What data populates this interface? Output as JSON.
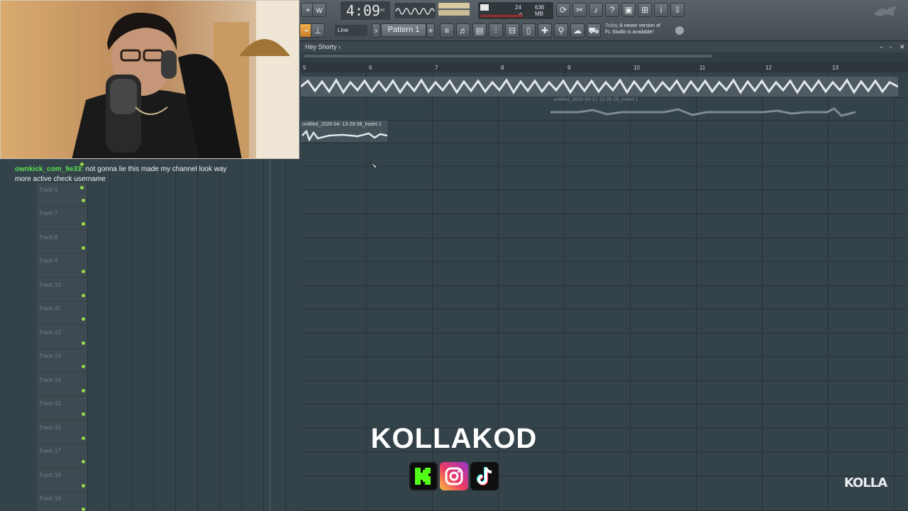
{
  "toolbar": {
    "time": "4:09",
    "time_small": "00",
    "time_unit": "B:S:T",
    "cpu_voices": "24",
    "cpu_zero": "0",
    "memory": "636 MB",
    "snap": "Line",
    "pattern": "Pattern 1",
    "news_today": "Today",
    "news_line1": "A newer version of",
    "news_line2": "FL Studio is available!"
  },
  "playlist": {
    "title": "Hey Shorty",
    "ruler_marks": [
      "5",
      "6",
      "7",
      "8",
      "9",
      "10",
      "11",
      "12",
      "13"
    ],
    "clip_top_label": "untitled_2026-04- 13-29-39_Insert 1",
    "clip_faint_label": "untitled_2026-04-12 13-26-28_Insert 1",
    "window_controls": [
      "–",
      "▫",
      "✕"
    ]
  },
  "tracks": [
    {
      "name": "Track 6"
    },
    {
      "name": "Track 7"
    },
    {
      "name": "Track 8"
    },
    {
      "name": "Track 9"
    },
    {
      "name": "Track 10"
    },
    {
      "name": "Track 11"
    },
    {
      "name": "Track 12"
    },
    {
      "name": "Track 13"
    },
    {
      "name": "Track 14"
    },
    {
      "name": "Track 15"
    },
    {
      "name": "Track 16"
    },
    {
      "name": "Track 17"
    },
    {
      "name": "Track 18"
    },
    {
      "name": "Track 19"
    }
  ],
  "chat": {
    "username": "ownkick_com_9e33:",
    "message": "not gonna lie this made my channel look way more active check username"
  },
  "branding": {
    "title": "KOLLAKOD",
    "watermark": "KOLLA",
    "social_icons": [
      "kick-icon",
      "instagram-icon",
      "tiktok-icon"
    ]
  },
  "colors": {
    "toolbar": "#4f585d",
    "playlist_bg": "#34424a",
    "led": "#98d94a",
    "chat_user": "#5ce04f"
  }
}
